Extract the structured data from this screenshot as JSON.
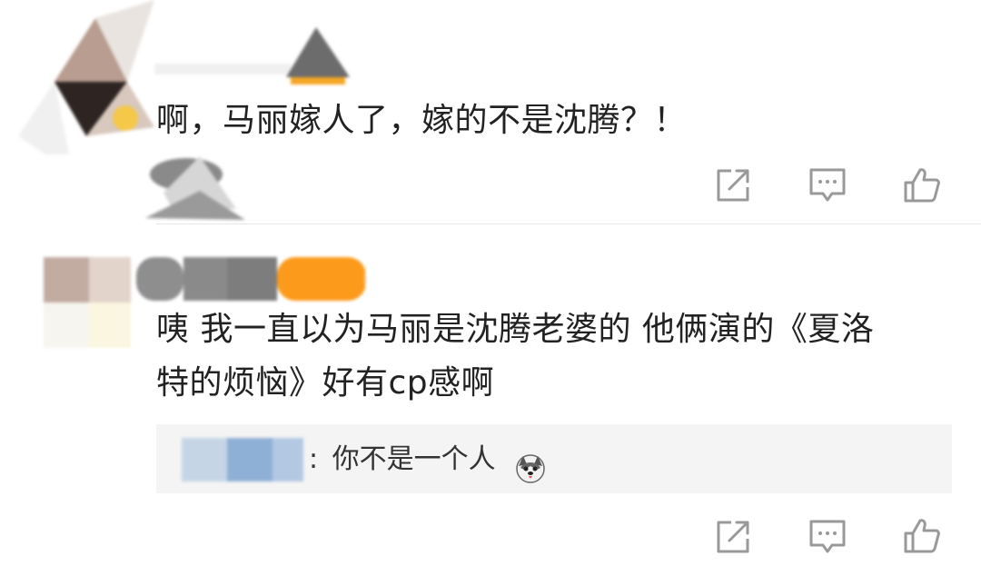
{
  "comments": [
    {
      "text": "啊，马丽嫁人了，嫁的不是沈腾？！"
    },
    {
      "text_line1": "咦 我一直以为马丽是沈腾老婆的 他俩演的《夏洛",
      "text_line2": "特的烦恼》好有cp感啊",
      "reply": {
        "separator": ":",
        "text": "你不是一个人"
      }
    }
  ],
  "icons": {
    "share": "share-icon",
    "comment": "comment-icon",
    "like": "thumbs-up-icon",
    "emoji": "husky-emoji-icon"
  },
  "colors": {
    "text": "#222222",
    "icon": "#999999",
    "reply_bg": "#f4f4f4",
    "divider": "#e6e6e6"
  }
}
